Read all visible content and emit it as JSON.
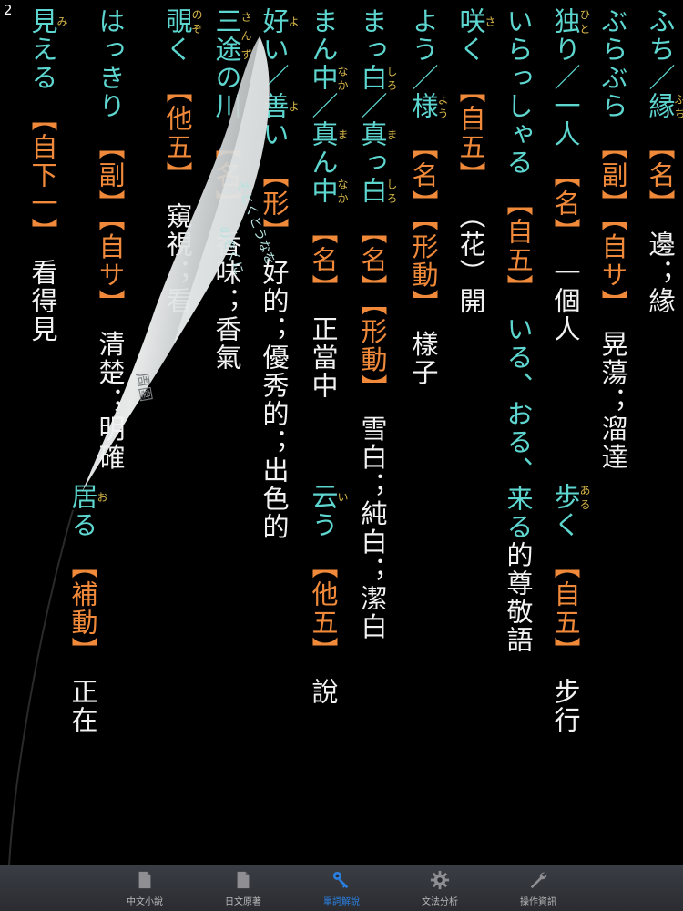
{
  "page_number": "2",
  "vocab": [
    {
      "word_html": "ふち／<ruby>縁<rt>ふち</rt></ruby>",
      "pos": "【名】",
      "meaning": "邊；緣"
    },
    {
      "word_html": "ぶらぶら",
      "pos": "【副】【自サ】",
      "meaning": "晃蕩；溜達"
    },
    {
      "word_html": "<ruby>独<rt>ひと</rt></ruby>り／一人",
      "pos": "【名】",
      "meaning": "一個人"
    },
    {
      "word_html": "いらっしゃる",
      "pos": "【自五】",
      "meaning_html": "<span class=\"word\">いる、おる、来る</span>的尊敬語"
    },
    {
      "word_html": "<ruby>咲<rt>さ</rt></ruby>く",
      "pos": "【自五】",
      "meaning": "（花）開"
    },
    {
      "word_html": "よう／<ruby>様<rt>よう</rt></ruby>",
      "pos": "【名】【形動】",
      "meaning": "樣子"
    },
    {
      "word_html": "まっ<ruby>白<rt>しろ</rt></ruby>／<ruby>真<rt>ま</rt></ruby>っ<ruby>白<rt>しろ</rt></ruby>",
      "pos": "【名】【形動】",
      "meaning": "雪白；純白；潔白"
    },
    {
      "word_html": "まん<ruby>中<rt>なか</rt></ruby>／<ruby>真<rt>ま</rt></ruby>ん<ruby>中<rt>なか</rt></ruby>",
      "pos": "【名】",
      "meaning": "正當中"
    },
    {
      "word_html": "<ruby>好<rt>よ</rt></ruby>い／<ruby>善<rt>よ</rt></ruby>い",
      "pos": "【形】",
      "meaning": "好的；優秀的；出色的"
    },
    {
      "word_html": "<ruby>三途<rt>さんず</rt></ruby>の川",
      "pos": "【名】",
      "meaning": "香味；香氣"
    },
    {
      "word_html": "<ruby>覗<rt>のぞ</rt></ruby>く",
      "pos": "【他五】",
      "meaning": "窺視；看"
    },
    {
      "word_html": "はっきり",
      "pos": "【副】【自サ】",
      "meaning": "清楚；明確"
    },
    {
      "word_html": "<ruby>見<rt>み</rt></ruby>える",
      "pos": "【自下一】",
      "meaning": "看得見"
    }
  ],
  "vocab_col2": [
    {
      "word_html": "<ruby>歩<rt>ある</rt></ruby>く",
      "pos": "【自五】",
      "meaning": "步行"
    },
    {
      "word_html": "<ruby>云<rt>い</rt></ruby>う",
      "pos": "【他五】",
      "meaning": "說"
    },
    {
      "word_html": "<ruby>居<rt>お</rt></ruby>る",
      "pos": "【補動】",
      "meaning": "正在"
    }
  ],
  "curl_back_text": [
    "のぞくに",
    "そとくとうなを",
    "周圍"
  ],
  "extra_fragments": {
    "around": "周圍",
    "buduan": "不斷地",
    "fu": "【副】"
  },
  "tabs": [
    {
      "label": "中文小說",
      "icon": "document-icon",
      "active": false
    },
    {
      "label": "日文原著",
      "icon": "document-icon",
      "active": false
    },
    {
      "label": "單詞解說",
      "icon": "key-icon",
      "active": true
    },
    {
      "label": "文法分析",
      "icon": "gear-icon",
      "active": false
    },
    {
      "label": "操作資訊",
      "icon": "wrench-icon",
      "active": false
    }
  ],
  "colors": {
    "background": "#000000",
    "word": "#5ed6d0",
    "pos": "#f08a3a",
    "meaning": "#f2f2f2",
    "furigana": "#d9b84a",
    "tab_active": "#2a7fe0"
  }
}
